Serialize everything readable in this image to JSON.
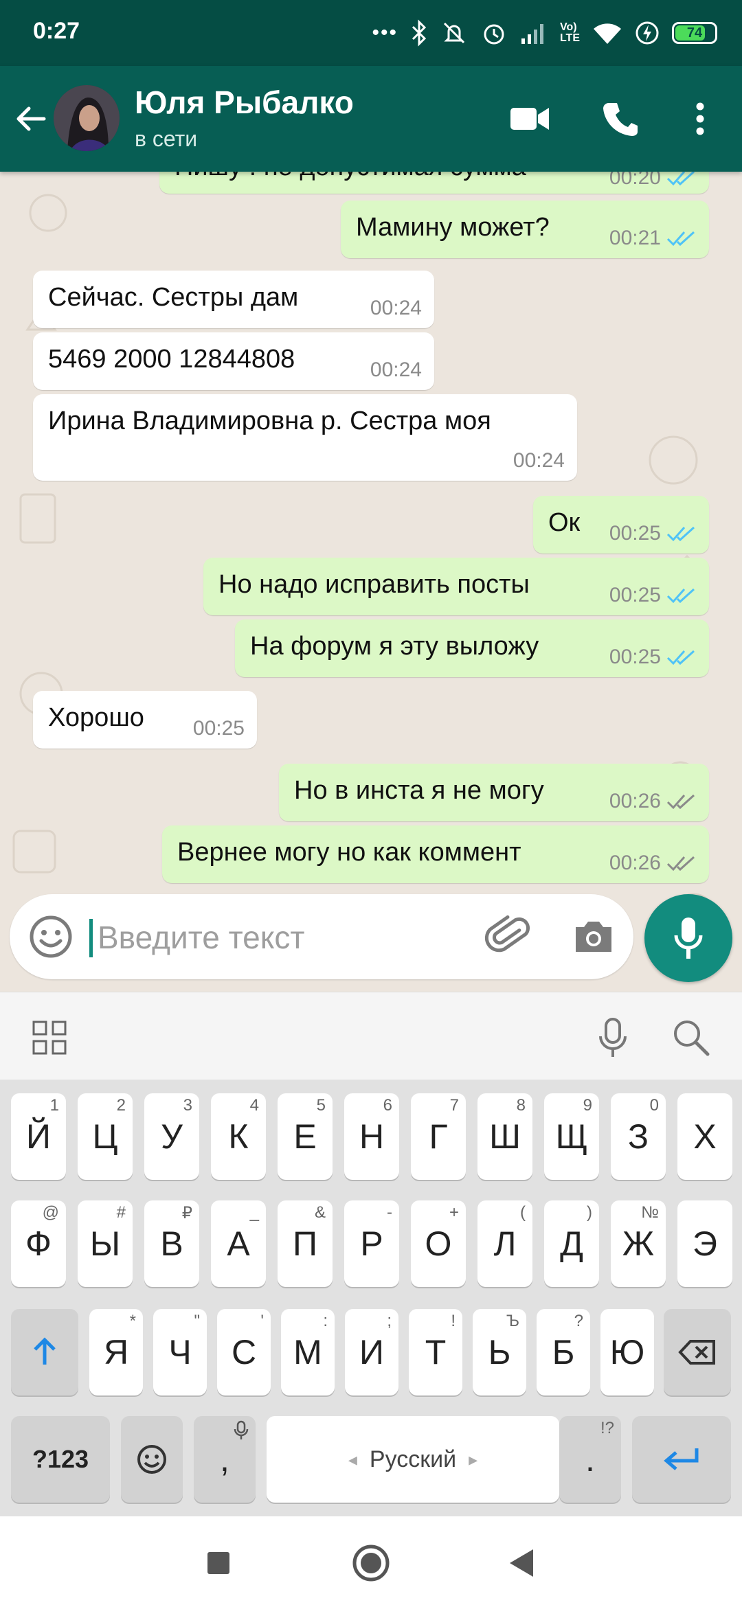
{
  "status_bar": {
    "time": "0:27",
    "battery": "74"
  },
  "header": {
    "contact_name": "Юля Рыбалко",
    "contact_status": "в сети"
  },
  "messages": [
    {
      "dir": "out",
      "text": "Пишу : не допустимая сумма",
      "time": "00:20",
      "ticks": "read"
    },
    {
      "dir": "out",
      "text": "Мамину может?",
      "time": "00:21",
      "ticks": "read"
    },
    {
      "dir": "in",
      "text": "Сейчас. Сестры дам",
      "time": "00:24"
    },
    {
      "dir": "in",
      "text": "5469 2000 12844808",
      "time": "00:24"
    },
    {
      "dir": "in",
      "text": "Ирина Владимировна р. Сестра моя",
      "time": "00:24"
    },
    {
      "dir": "out",
      "text": "Ок",
      "time": "00:25",
      "ticks": "read"
    },
    {
      "dir": "out",
      "text": "Но надо исправить посты",
      "time": "00:25",
      "ticks": "read"
    },
    {
      "dir": "out",
      "text": "На форум я эту выложу",
      "time": "00:25",
      "ticks": "read"
    },
    {
      "dir": "in",
      "text": "Хорошо",
      "time": "00:25"
    },
    {
      "dir": "out",
      "text": "Но в инста я не могу",
      "time": "00:26",
      "ticks": "delivered"
    },
    {
      "dir": "out",
      "text": "Вернее могу но как коммент",
      "time": "00:26",
      "ticks": "delivered"
    }
  ],
  "composer": {
    "placeholder": "Введите текст"
  },
  "keyboard": {
    "row1": [
      {
        "k": "Й",
        "s": "1"
      },
      {
        "k": "Ц",
        "s": "2"
      },
      {
        "k": "У",
        "s": "3"
      },
      {
        "k": "К",
        "s": "4"
      },
      {
        "k": "Е",
        "s": "5"
      },
      {
        "k": "Н",
        "s": "6"
      },
      {
        "k": "Г",
        "s": "7"
      },
      {
        "k": "Ш",
        "s": "8"
      },
      {
        "k": "Щ",
        "s": "9"
      },
      {
        "k": "З",
        "s": "0"
      },
      {
        "k": "Х",
        "s": ""
      }
    ],
    "row2": [
      {
        "k": "Ф",
        "s": "@"
      },
      {
        "k": "Ы",
        "s": "#"
      },
      {
        "k": "В",
        "s": "₽"
      },
      {
        "k": "А",
        "s": "_"
      },
      {
        "k": "П",
        "s": "&"
      },
      {
        "k": "Р",
        "s": "-"
      },
      {
        "k": "О",
        "s": "+"
      },
      {
        "k": "Л",
        "s": "("
      },
      {
        "k": "Д",
        "s": ")"
      },
      {
        "k": "Ж",
        "s": "№"
      },
      {
        "k": "Э",
        "s": ""
      }
    ],
    "row3": [
      {
        "k": "Я",
        "s": "*"
      },
      {
        "k": "Ч",
        "s": "\""
      },
      {
        "k": "С",
        "s": "'"
      },
      {
        "k": "М",
        "s": ":"
      },
      {
        "k": "И",
        "s": ";"
      },
      {
        "k": "Т",
        "s": "!"
      },
      {
        "k": "Ь",
        "s": "Ъ"
      },
      {
        "k": "Б",
        "s": "?"
      },
      {
        "k": "Ю",
        "s": ""
      }
    ],
    "symbols_label": "?123",
    "comma_label": ",",
    "space_label": "Русский",
    "period_label": ".",
    "period_sup": "!?"
  },
  "colors": {
    "header": "#075e54",
    "status_bar": "#054d44",
    "accent": "#128c7e",
    "outgoing": "#dcf8c6",
    "incoming": "#ffffff",
    "read_ticks": "#4fc3f7"
  }
}
